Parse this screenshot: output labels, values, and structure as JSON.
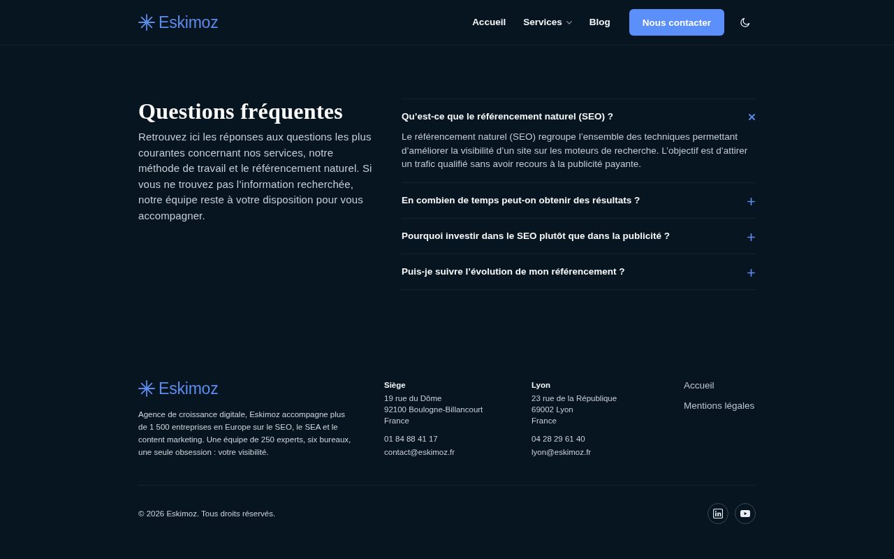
{
  "header": {
    "logo": "Eskimoz",
    "nav": [
      {
        "label": "Accueil",
        "kind": "link"
      },
      {
        "label": "Services",
        "kind": "dropdown"
      },
      {
        "label": "Blog",
        "kind": "link"
      }
    ],
    "cta": "Nous contacter"
  },
  "faq": {
    "title": "Questions fréquentes",
    "intro": "Retrouvez ici les réponses aux questions les plus courantes concernant nos services, notre méthode de travail et le référencement naturel. Si vous ne trouvez pas l’information recherchée, notre équipe reste à votre disposition pour vous accompagner.",
    "items": [
      {
        "question": "Qu’est-ce que le référencement naturel (SEO) ?",
        "expanded": true,
        "answer": "Le référencement naturel (SEO) regroupe l’ensemble des techniques permettant d’améliorer la visibilité d’un site sur les moteurs de recherche. L’objectif est d’attirer un trafic qualifié sans avoir recours à la publicité payante."
      },
      {
        "question": "En combien de temps peut-on obtenir des résultats ?",
        "expanded": false
      },
      {
        "question": "Pourquoi investir dans le SEO plutôt que dans la publicité ?",
        "expanded": false
      },
      {
        "question": "Puis-je suivre l’évolution de mon référencement ?",
        "expanded": false
      }
    ]
  },
  "footer": {
    "logo": "Eskimoz",
    "description": "Agence de croissance digitale, Eskimoz accompagne plus de 1 500 entreprises en Europe sur le SEO, le SEA et le content marketing. Une équipe de 250 experts, six bureaux, une seule obsession : votre visibilité.",
    "offices": [
      {
        "name": "Siège",
        "address": [
          "19 rue du Dôme",
          "92100 Boulogne-Billancourt",
          "France"
        ],
        "phone": "01 84 88 41 17",
        "email": "contact@eskimoz.fr"
      },
      {
        "name": "Lyon",
        "address": [
          "23 rue de la République",
          "69002 Lyon",
          "France"
        ],
        "phone": "04 28 29 61 40",
        "email": "lyon@eskimoz.fr"
      }
    ],
    "links": [
      "Accueil",
      "Mentions légales"
    ],
    "copyright": "© 2026 Eskimoz. Tous droits réservés.",
    "social": [
      {
        "kind": "linkedin"
      },
      {
        "kind": "youtube"
      }
    ]
  }
}
